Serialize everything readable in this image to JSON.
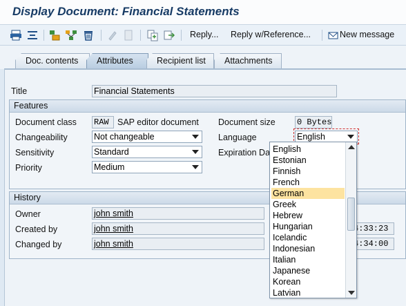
{
  "window": {
    "title": "Display Document: Financial Statements"
  },
  "toolbar": {
    "icons": [
      "print-icon",
      "filter-icon",
      "create-icon",
      "structure-icon",
      "delete-icon",
      "edit-icon",
      "change-icon",
      "copy-icon",
      "forward-icon"
    ],
    "reply_label": "Reply...",
    "reply_ref_label": "Reply w/Reference...",
    "new_message_label": "New message"
  },
  "tabs": [
    {
      "label": "Doc. contents",
      "active": false
    },
    {
      "label": "Attributes",
      "active": true
    },
    {
      "label": "Recipient list",
      "active": false
    },
    {
      "label": "Attachments",
      "active": false
    }
  ],
  "form": {
    "title_label": "Title",
    "title_value": "Financial Statements"
  },
  "features": {
    "heading": "Features",
    "doc_class_label": "Document class",
    "doc_class_code": "RAW",
    "doc_class_desc": "SAP editor document",
    "changeability_label": "Changeability",
    "changeability_value": "Not changeable",
    "sensitivity_label": "Sensitivity",
    "sensitivity_value": "Standard",
    "priority_label": "Priority",
    "priority_value": "Medium",
    "doc_size_label": "Document size",
    "doc_size_value": "0 Bytes",
    "language_label": "Language",
    "language_value": "English",
    "expiration_label": "Expiration Dat"
  },
  "history": {
    "heading": "History",
    "owner_label": "Owner",
    "owner_value": "john smith",
    "created_label": "Created by",
    "created_value": "john smith",
    "created_time": "4:33:23",
    "changed_label": "Changed by",
    "changed_value": "john smith",
    "changed_time": "4:34:00"
  },
  "language_dropdown": {
    "options": [
      "English",
      "Estonian",
      "Finnish",
      "French",
      "German",
      "Greek",
      "Hebrew",
      "Hungarian",
      "Icelandic",
      "Indonesian",
      "Italian",
      "Japanese",
      "Korean",
      "Latvian"
    ],
    "highlighted": "German"
  },
  "colors": {
    "title_text": "#173b65",
    "highlight": "#fde3a0",
    "background": "#dfe9f3"
  }
}
